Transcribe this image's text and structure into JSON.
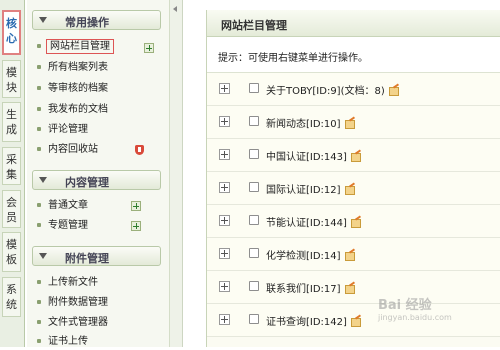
{
  "vertical_tabs": [
    {
      "label": "核心",
      "active": true
    },
    {
      "label": "模块",
      "active": false
    },
    {
      "label": "生成",
      "active": false
    },
    {
      "label": "采集",
      "active": false
    },
    {
      "label": "会员",
      "active": false
    },
    {
      "label": "模板",
      "active": false
    },
    {
      "label": "系统",
      "active": false
    }
  ],
  "menu": {
    "sections": [
      {
        "title": "常用操作",
        "items": [
          "网站栏目管理",
          "所有档案列表",
          "等审核的档案",
          "我发布的文档",
          "评论管理",
          "内容回收站"
        ]
      },
      {
        "title": "内容管理",
        "items": [
          "普通文章",
          "专题管理"
        ]
      },
      {
        "title": "附件管理",
        "items": [
          "上传新文件",
          "附件数据管理",
          "文件式管理器",
          "证书上传"
        ]
      }
    ]
  },
  "main": {
    "title": "网站栏目管理",
    "hint": "提示：可使用右键菜单进行操作。",
    "rows": [
      "关于TOBY[ID:9](文档：8)",
      "新闻动态[ID:10]",
      "中国认证[ID:143]",
      "国际认证[ID:12]",
      "节能认证[ID:144]",
      "化学检测[ID:14]",
      "联系我们[ID:17]",
      "证书查询[ID:142]"
    ]
  },
  "watermark": {
    "text": "Bai 经验",
    "sub": "jingyan.baidu.com"
  },
  "colors": {
    "accent_red": "#d55555",
    "panel_bg": "#f6f8f1",
    "row_bg": "#fdfdf3"
  }
}
